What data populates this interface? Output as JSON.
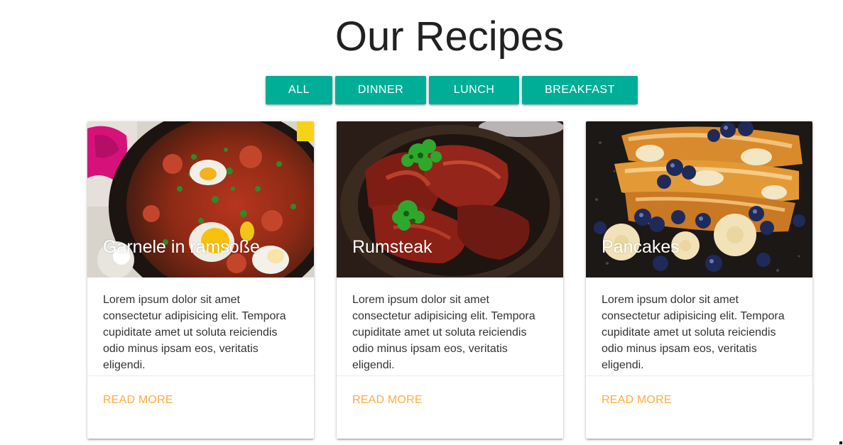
{
  "page": {
    "title": "Our Recipes"
  },
  "filters": [
    {
      "label": "ALL"
    },
    {
      "label": "DINNER"
    },
    {
      "label": "LUNCH"
    },
    {
      "label": "BREAKFAST"
    }
  ],
  "colors": {
    "accent": "#00ae98",
    "link": "#ffab40",
    "title": "#212121"
  },
  "cards": [
    {
      "title": "Garnele in ramsoße",
      "text": "Lorem ipsum dolor sit amet consectetur adipisicing elit. Tempora cupiditate amet ut soluta reiciendis odio minus ipsam eos, veritatis eligendi.",
      "link": "READ MORE",
      "image": "shakshuka-photo"
    },
    {
      "title": "Rumsteak",
      "text": "Lorem ipsum dolor sit amet consectetur adipisicing elit. Tempora cupiditate amet ut soluta reiciendis odio minus ipsam eos, veritatis eligendi.",
      "link": "READ MORE",
      "image": "grilled-meat-photo"
    },
    {
      "title": "Pancakes",
      "text": "Lorem ipsum dolor sit amet consectetur adipisicing elit. Tempora cupiditate amet ut soluta reiciendis odio minus ipsam eos, veritatis eligendi.",
      "link": "READ MORE",
      "image": "french-toast-photo"
    }
  ]
}
